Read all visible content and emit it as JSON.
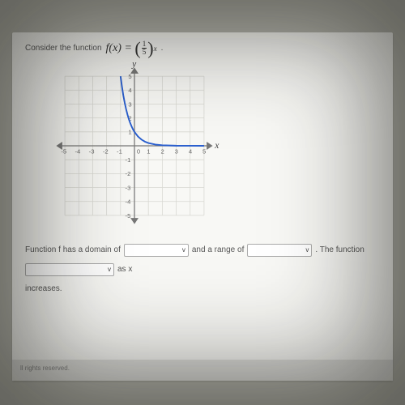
{
  "question": {
    "intro": "Consider the function",
    "fx_label": "f(x)",
    "equals": "=",
    "frac_num": "1",
    "frac_den": "5",
    "exponent": "x",
    "period": "."
  },
  "chart_data": {
    "type": "line",
    "title": "",
    "xlabel": "x",
    "ylabel": "y",
    "xlim": [
      -5,
      5
    ],
    "ylim": [
      -5,
      5
    ],
    "x_ticks": [
      -5,
      -4,
      -3,
      -2,
      -1,
      0,
      1,
      2,
      3,
      4,
      5
    ],
    "y_ticks": [
      -5,
      -4,
      -3,
      -2,
      -1,
      1,
      2,
      3,
      4,
      5
    ],
    "series": [
      {
        "name": "f(x)=(1/5)^x",
        "points": [
          [
            -1.0,
            5.0
          ],
          [
            -0.9,
            4.26
          ],
          [
            -0.8,
            3.62
          ],
          [
            -0.7,
            3.09
          ],
          [
            -0.6,
            2.63
          ],
          [
            -0.5,
            2.24
          ],
          [
            -0.4,
            1.9
          ],
          [
            -0.3,
            1.62
          ],
          [
            -0.2,
            1.38
          ],
          [
            -0.1,
            1.17
          ],
          [
            0.0,
            1.0
          ],
          [
            0.25,
            0.67
          ],
          [
            0.5,
            0.45
          ],
          [
            0.75,
            0.3
          ],
          [
            1.0,
            0.2
          ],
          [
            1.5,
            0.09
          ],
          [
            2.0,
            0.04
          ],
          [
            3.0,
            0.008
          ],
          [
            4.0,
            0.0016
          ],
          [
            5.0,
            0.00032
          ]
        ]
      }
    ]
  },
  "answer": {
    "t1": "Function f has a domain of",
    "t2": "and a range of",
    "t3": ". The function",
    "t4": "as x",
    "t5": "increases."
  },
  "footer_text": "ll rights reserved.",
  "icons": {
    "chevron": "v"
  }
}
